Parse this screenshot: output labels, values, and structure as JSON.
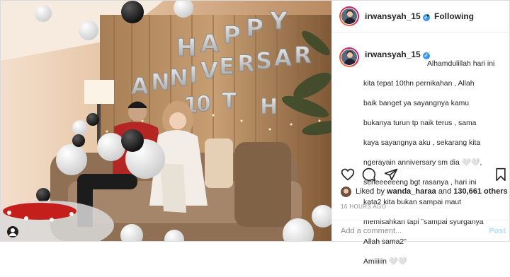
{
  "post": {
    "author": "irwansyah_15",
    "verified_mark": "✓",
    "follow_separator": "•",
    "follow_status": "Following",
    "caption_lines": [
      "Alhamdulillah hari ini",
      "kita tepat 10thn pernikahan ,  Allah",
      "baik banget ya sayangnya kamu",
      "bukanya turun tp naik terus , sama",
      "kaya sayangnya aku , sekarang kita",
      "ngerayain anniversary sm dia 🤍🤍,",
      "seneeeeeeng bgt rasanya , hari ini",
      "kata2 kita bukan sampai maut",
      "memisahkan tapi \"sampai syurganya",
      "Allah sama2\"",
      "Amiiiiin 🤍🤍"
    ],
    "liked_by_prefix": "Liked by",
    "liked_by_user": "wanda_haraa",
    "liked_and": "and",
    "liked_others": "130,661 others",
    "timestamp": "16 HOURS AGO",
    "comment_placeholder": "Add a comment...",
    "post_label": "Post"
  },
  "photo": {
    "balloon_letters_row1": [
      "H",
      "A",
      "P",
      "P",
      "Y"
    ],
    "balloon_letters_row2": [
      "A",
      "N",
      "N",
      "I",
      "V",
      "E",
      "R",
      "S",
      "A",
      "R"
    ],
    "balloon_letters_row3": [
      "1",
      "0",
      "T",
      "H"
    ]
  },
  "icons": {
    "heart": "heart-icon",
    "comment": "comment-icon",
    "share": "share-icon",
    "save": "bookmark-icon",
    "verified": "verified-badge-icon"
  },
  "colors": {
    "verified_blue": "#3897f0",
    "post_button": "#b2dffc",
    "muted_text": "#8e8e8e"
  }
}
